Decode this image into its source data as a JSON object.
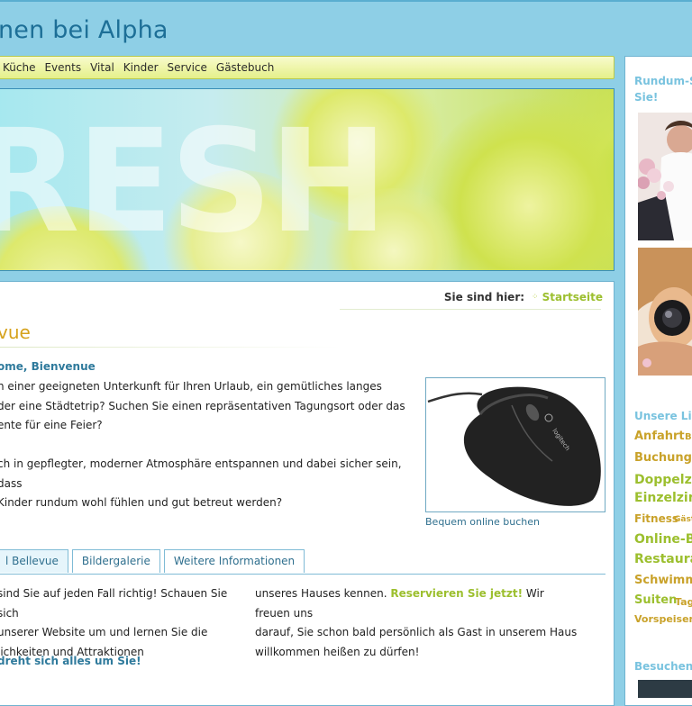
{
  "site": {
    "title": "nen bei Alpha"
  },
  "nav": {
    "items": [
      "Küche",
      "Events",
      "Vital",
      "Kinder",
      "Service",
      "Gästebuch"
    ]
  },
  "banner": {
    "word": "RESH"
  },
  "breadcrumb": {
    "label": "Sie sind hier:",
    "link": "Startseite"
  },
  "page": {
    "heading": "vue",
    "subheading": "ome, Bienvenue",
    "intro_lines": [
      "n einer geeigneten Unterkunft für Ihren Urlaub, ein gemütliches langes",
      "der eine Städtetrip? Suchen Sie einen repräsentativen Tagungsort oder das",
      "ente für eine Feier?",
      "",
      "ch in gepflegter, moderner Atmosphäre entspannen und dabei sicher sein, dass",
      "Kinder rundum wohl fühlen und gut betreut werden?"
    ],
    "image_caption": "Bequem online buchen",
    "mouse_brand": "logitech"
  },
  "tabs": [
    "l Bellevue",
    "Bildergalerie",
    "Weitere Informationen"
  ],
  "tab_content": {
    "col1": [
      "sind Sie auf jeden Fall richtig! Schauen Sie sich",
      "unserer Website um und lernen Sie die",
      "lichkeiten und Attraktionen"
    ],
    "col2_line1_pre": "unseres Hauses kennen. ",
    "col2_line1_link": "Reservieren Sie jetzt!",
    "col2_line1_post": " Wir freuen uns",
    "col2_rest": [
      "darauf, Sie schon bald persönlich als Gast in unserem Haus",
      "willkommen heißen zu dürfen!"
    ],
    "closing": "dreht sich alles um Sie!"
  },
  "sidebar": {
    "heading1": [
      "Rundum-Se",
      "Sie!"
    ],
    "heading2": "Unsere Lin",
    "heading3": "Besuchen S",
    "tags": [
      {
        "text": "Anfahrt",
        "color": "#c9a22a"
      },
      {
        "text": "Ba",
        "color": "#c9a22a"
      },
      {
        "text": "Buchung O",
        "color": "#c9a22a"
      },
      {
        "text": "Doppelzin",
        "color": "#9cbf2e"
      },
      {
        "text": "Einzelzimn",
        "color": "#9cbf2e"
      },
      {
        "text": "Fitness",
        "color": "#c9a22a"
      },
      {
        "text": "Gäste",
        "color": "#c9a22a"
      },
      {
        "text": "Online-Bu",
        "color": "#9cbf2e"
      },
      {
        "text": "Restaura",
        "color": "#9cbf2e"
      },
      {
        "text": "Schwimmb",
        "color": "#c9a22a"
      },
      {
        "text": "Suiten",
        "color": "#9cbf2e"
      },
      {
        "text": "Tagu",
        "color": "#c9a22a"
      },
      {
        "text": "Vorspeisen",
        "color": "#c9a22a"
      }
    ]
  }
}
